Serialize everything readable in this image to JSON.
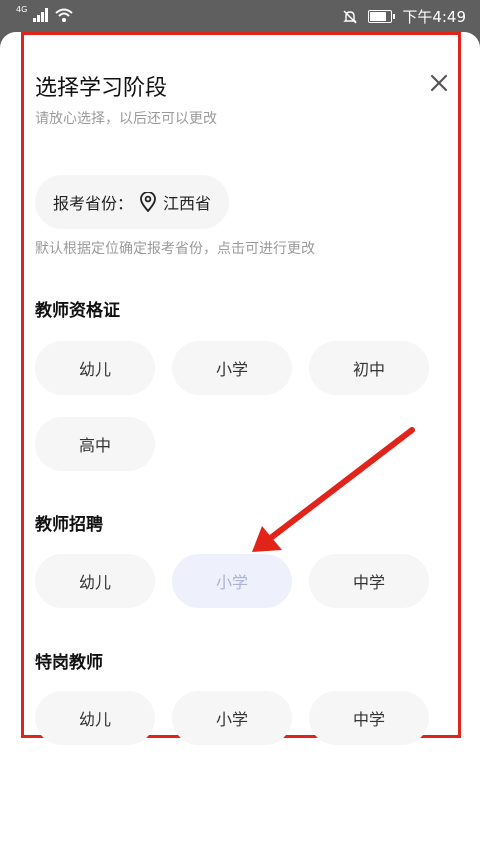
{
  "status": {
    "network": "4G",
    "time": "下午4:49",
    "battery_level": 0.85
  },
  "sheet": {
    "title": "选择学习阶段",
    "subtitle": "请放心选择，以后还可以更改",
    "province_label": "报考省份：",
    "province_value": "江西省",
    "province_hint": "默认根据定位确定报考省份，点击可进行更改"
  },
  "sections": [
    {
      "title": "教师资格证",
      "options": [
        "幼儿",
        "小学",
        "初中",
        "高中"
      ]
    },
    {
      "title": "教师招聘",
      "options": [
        "幼儿",
        "小学",
        "中学"
      ],
      "selected": "小学"
    },
    {
      "title": "特岗教师",
      "options": [
        "幼儿",
        "小学",
        "中学"
      ]
    }
  ],
  "colors": {
    "annotation_red": "#e2231a",
    "selected_bg": "#eef1fc",
    "selected_text": "#a9b1d6"
  }
}
